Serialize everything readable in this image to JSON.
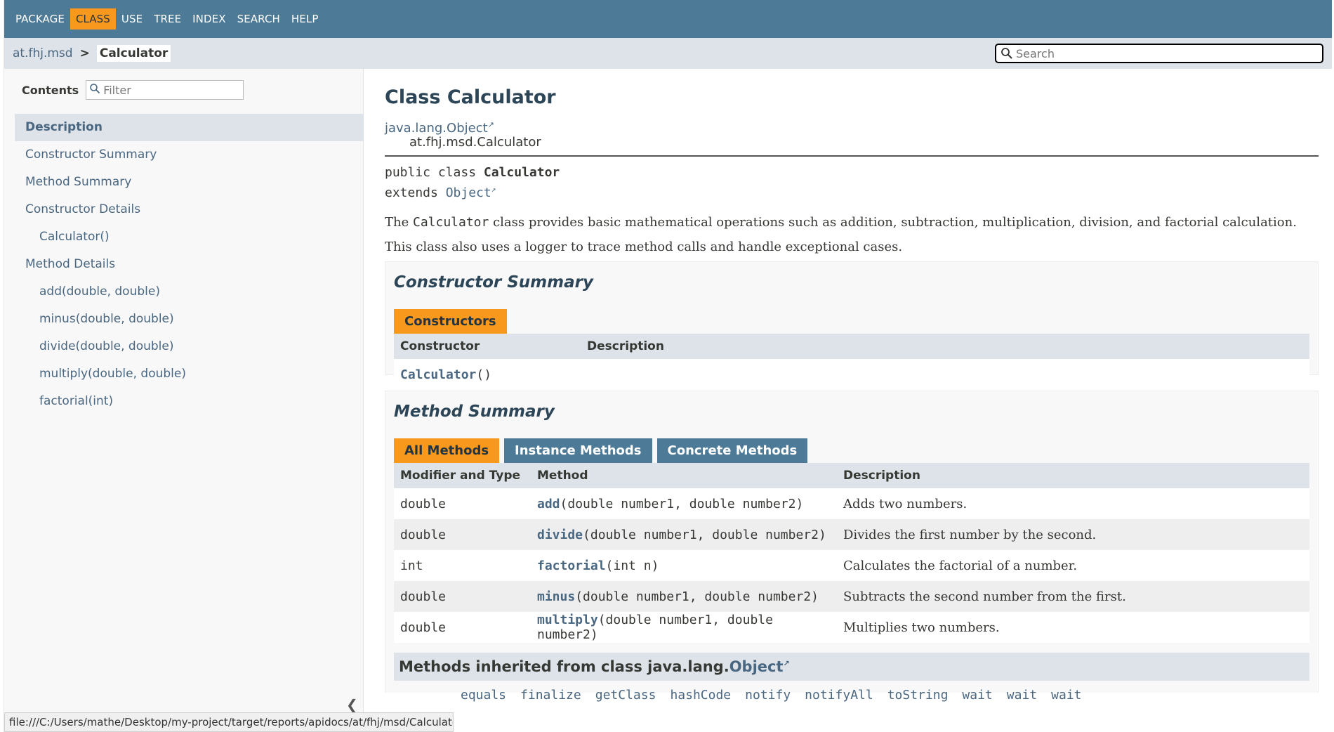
{
  "topnav": {
    "items": [
      "PACKAGE",
      "CLASS",
      "USE",
      "TREE",
      "INDEX",
      "SEARCH",
      "HELP"
    ]
  },
  "subnav": {
    "package": "at.fhj.msd",
    "separator": ">",
    "current": "Calculator",
    "search_placeholder": "Search"
  },
  "sidebar": {
    "contents_label": "Contents",
    "filter_placeholder": "Filter",
    "items": [
      {
        "label": "Description"
      },
      {
        "label": "Constructor Summary"
      },
      {
        "label": "Method Summary"
      },
      {
        "label": "Constructor Details"
      },
      {
        "label": "Calculator()"
      },
      {
        "label": "Method Details"
      },
      {
        "label": "add(double, double)"
      },
      {
        "label": "minus(double, double)"
      },
      {
        "label": "divide(double, double)"
      },
      {
        "label": "multiply(double, double)"
      },
      {
        "label": "factorial(int)"
      }
    ],
    "collapse_glyph": "❮"
  },
  "status_url": "file:///C:/Users/mathe/Desktop/my-project/target/reports/apidocs/at/fhj/msd/Calculator.ht...",
  "main": {
    "title": "Class Calculator",
    "parent_class": "java.lang.Object",
    "child_class": "at.fhj.msd.Calculator",
    "sig_line1_prefix": "public class ",
    "sig_line1_name": "Calculator",
    "sig_line2_prefix": "extends ",
    "sig_line2_link": "Object",
    "desc1_pre": "The ",
    "desc1_code": "Calculator",
    "desc1_post": " class provides basic mathematical operations such as addition, subtraction, multiplication, division, and factorial calculation.",
    "desc2": "This class also uses a logger to trace method calls and handle exceptional cases.",
    "constructor_summary": {
      "heading": "Constructor Summary",
      "tab": "Constructors",
      "col_constructor": "Constructor",
      "col_description": "Description",
      "row_name": "Calculator",
      "row_params": "()"
    },
    "method_summary": {
      "heading": "Method Summary",
      "tabs": [
        "All Methods",
        "Instance Methods",
        "Concrete Methods"
      ],
      "col_modifier": "Modifier and Type",
      "col_method": "Method",
      "col_description": "Description",
      "rows": [
        {
          "type": "double",
          "name": "add",
          "params": "(double number1, double number2)",
          "desc": "Adds two numbers."
        },
        {
          "type": "double",
          "name": "divide",
          "params": "(double number1, double number2)",
          "desc": "Divides the first number by the second."
        },
        {
          "type": "int",
          "name": "factorial",
          "params": "(int n)",
          "desc": "Calculates the factorial of a number."
        },
        {
          "type": "double",
          "name": "minus",
          "params": "(double number1, double number2)",
          "desc": "Subtracts the second number from the first."
        },
        {
          "type": "double",
          "name": "multiply",
          "params": "(double number1, double number2)",
          "desc": "Multiplies two numbers."
        }
      ]
    },
    "inherited": {
      "prefix": "Methods inherited from class java.lang.",
      "link": "Object",
      "methods": [
        "equals",
        "finalize",
        "getClass",
        "hashCode",
        "notify",
        "notifyAll",
        "toString",
        "wait",
        "wait",
        "wait"
      ]
    }
  },
  "colors": {
    "nav_bg": "#4d7a97",
    "accent": "#f8981d",
    "subnav_bg": "#dee3e9",
    "link": "#4a6782"
  }
}
